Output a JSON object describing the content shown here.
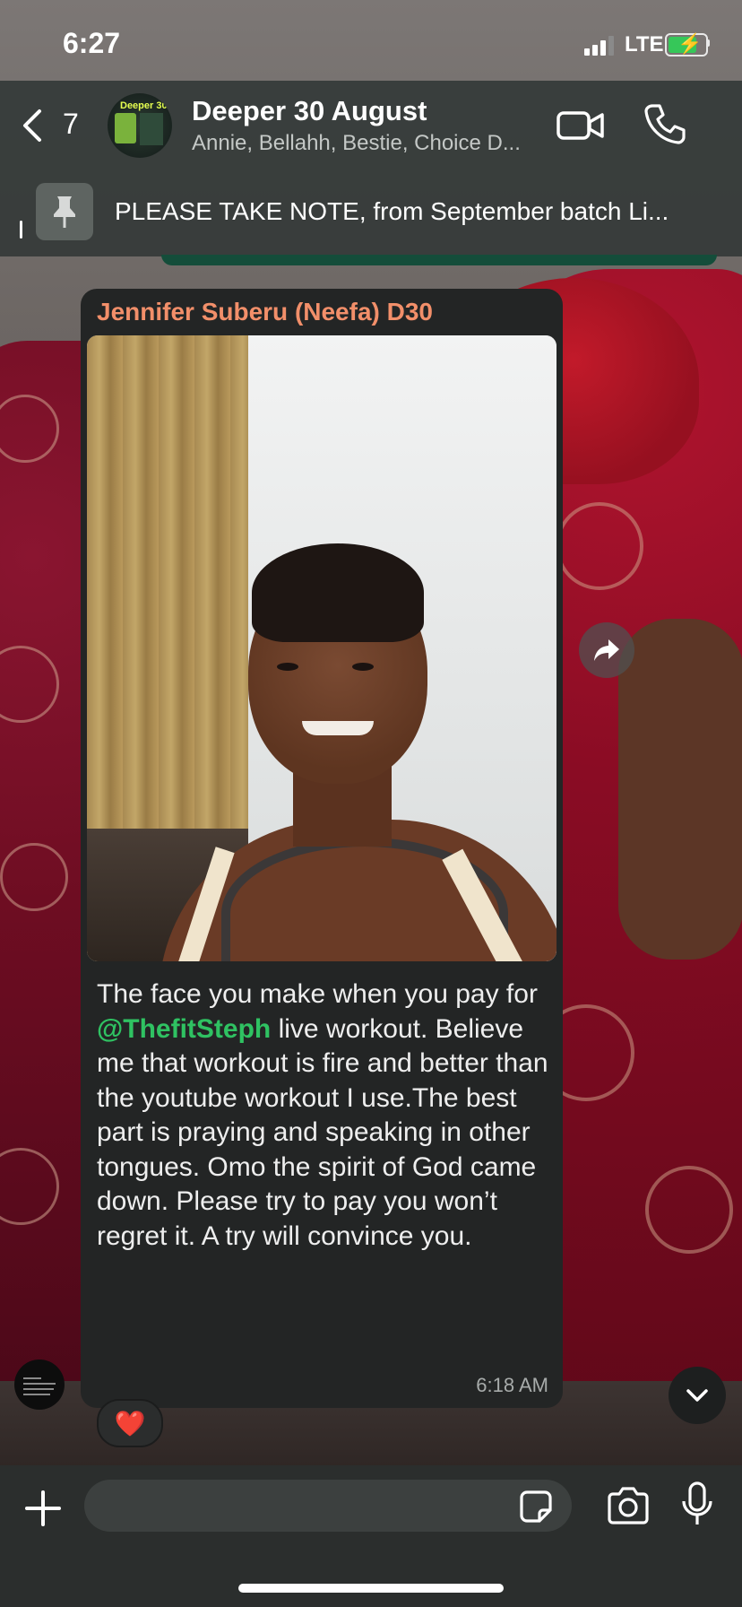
{
  "status_bar": {
    "time": "6:27",
    "network": "LTE",
    "battery_level": 0.85,
    "battery_charging": true,
    "signal_bars": 3
  },
  "header": {
    "back_count": "7",
    "group_name": "Deeper 30 August",
    "members": "Annie, Bellahh, Bestie, Choice D...",
    "avatar_text": "Deeper 30",
    "icons": {
      "back": "chevron-left-icon",
      "video": "video-camera-icon",
      "call": "phone-icon"
    }
  },
  "pinned": {
    "text": "PLEASE TAKE NOTE, from September batch Li...",
    "icon": "pin-icon"
  },
  "message": {
    "sender": "Jennifer Suberu (Neefa) D30",
    "text_before": "The face you make when you pay for ",
    "mention": "@ThefitSteph",
    "text_after": " live workout. Believe me that workout is fire and better than the youtube workout I use.The best part is praying and speaking in other tongues. Omo the spirit of God came down. Please try to pay you won’t regret it. A try will convince you.",
    "time": "6:18 AM",
    "reaction": "❤️"
  },
  "colors": {
    "sender_name": "#f28f6a",
    "mention": "#2fc262",
    "bubble": "#232525",
    "header_bg": "#343a38"
  },
  "input_bar": {
    "placeholder": "",
    "icons": [
      "plus-icon",
      "sticker-icon",
      "camera-icon",
      "microphone-icon"
    ]
  }
}
